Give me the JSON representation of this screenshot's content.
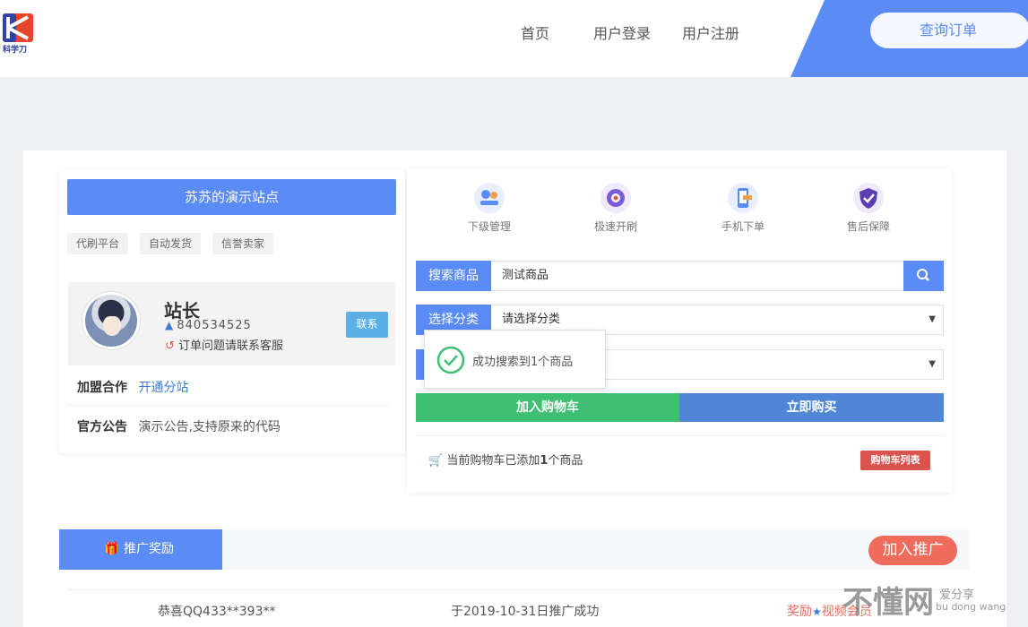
{
  "header": {
    "logo_text": "科学刀",
    "nav": [
      "首页",
      "用户登录",
      "用户注册"
    ],
    "order_query": "查询订单"
  },
  "site": {
    "title": "苏苏的演示站点",
    "tags": [
      "代刷平台",
      "自动发货",
      "信誉卖家"
    ]
  },
  "profile": {
    "name": "站长",
    "qq": "840534525",
    "note": "订单问题请联系客服",
    "contact_button": "联系"
  },
  "info": {
    "join_label": "加盟合作",
    "join_link": "开通分站",
    "notice_label": "官方公告",
    "notice_text": "演示公告,支持原来的代码"
  },
  "features": [
    {
      "label": "下级管理",
      "icon": "team-icon"
    },
    {
      "label": "极速开刷",
      "icon": "rocket-icon"
    },
    {
      "label": "手机下单",
      "icon": "phone-icon"
    },
    {
      "label": "售后保障",
      "icon": "shield-icon"
    }
  ],
  "form": {
    "search_label": "搜索商品",
    "search_value": "测试商品",
    "category_label": "选择分类",
    "category_value": "请选择分类"
  },
  "toast": {
    "message": "成功搜索到1个商品"
  },
  "actions": {
    "add_cart": "加入购物车",
    "buy_now": "立即购买"
  },
  "cart": {
    "status_prefix": "当前购物车已添加",
    "count": "1",
    "status_suffix": "个商品",
    "list_button": "购物车列表"
  },
  "promo": {
    "tab_label": "推广奖励",
    "join_button": "加入推广",
    "rows": [
      {
        "user": "恭喜QQ433**393**",
        "date": "于2019-10-31日推广成功",
        "reward_prefix": "奖励",
        "reward_suffix": "视频会员"
      }
    ]
  },
  "watermark": {
    "main": "不懂网",
    "sub": "爱分享",
    "pinyin": "bu dong wang"
  },
  "colors": {
    "primary": "#5b8bf5",
    "success": "#3fbf74",
    "danger": "#d9534f",
    "promo": "#ef6b5c"
  }
}
